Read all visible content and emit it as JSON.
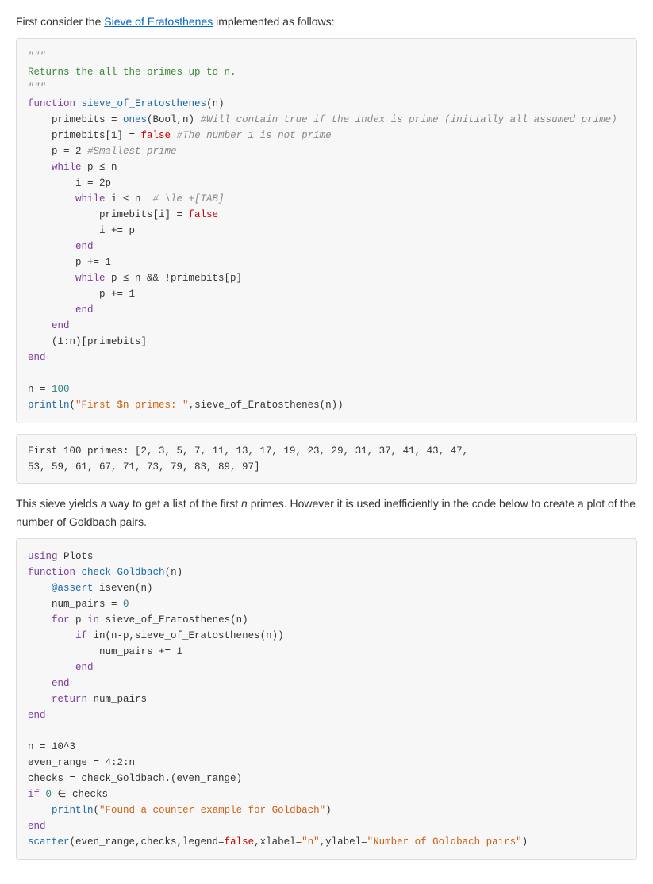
{
  "intro": {
    "text_before_link": "First consider the ",
    "link_text": "Sieve of Eratosthenes",
    "text_after_link": " implemented as follows:"
  },
  "code_block_1": {
    "lines": []
  },
  "output_block_1": {
    "text": "First 100 primes: [2, 3, 5, 7, 11, 13, 17, 19, 23, 29, 31, 37, 41, 43, 47,\n53, 59, 61, 67, 71, 73, 79, 83, 89, 97]"
  },
  "mid_paragraph": {
    "text": "This sieve yields a way to get a list of the first n primes. However it is used inefficiently in the code below to create a plot of the number of Goldbach pairs."
  },
  "code_block_2": {
    "lines": []
  }
}
